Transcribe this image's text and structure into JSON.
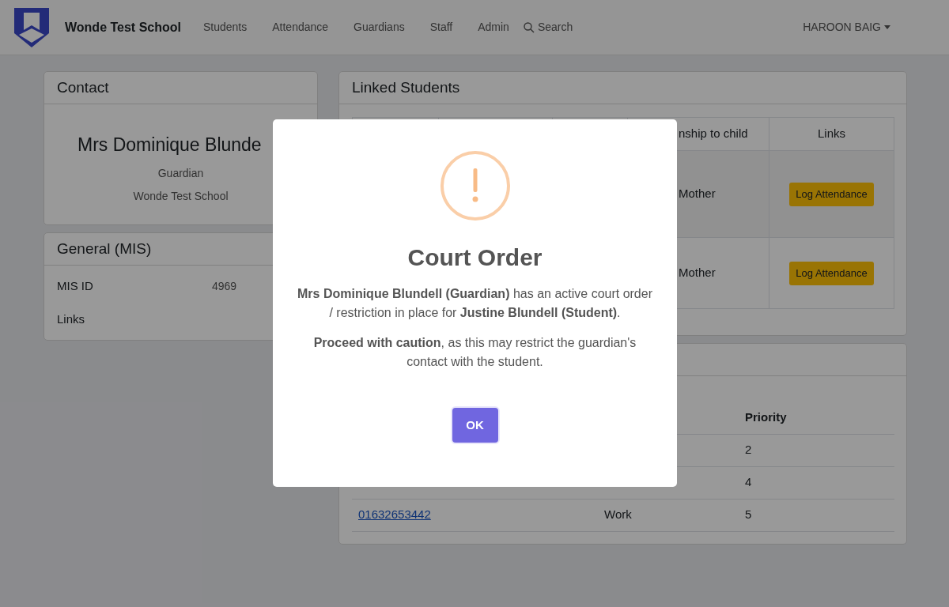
{
  "navbar": {
    "brand": "Wonde Test School",
    "items": [
      {
        "label": "Students"
      },
      {
        "label": "Attendance"
      },
      {
        "label": "Guardians"
      },
      {
        "label": "Staff"
      },
      {
        "label": "Admin"
      }
    ],
    "search": "Search",
    "user": "HAROON BAIG"
  },
  "contact_card": {
    "title": "Contact",
    "name": "Mrs Dominique Blunde",
    "role": "Guardian",
    "school": "Wonde Test School"
  },
  "general_card": {
    "title": "General (MIS)",
    "fields": [
      {
        "label": "MIS ID",
        "value": "4969"
      },
      {
        "label": "Links"
      }
    ]
  },
  "linked_students": {
    "title": "Linked Students",
    "columns": [
      "nship to child",
      "Links"
    ],
    "rows": [
      {
        "relationship": "Mother",
        "button": "Log Attendance"
      },
      {
        "relationship": "Mother",
        "button": "Log Attendance"
      }
    ]
  },
  "contacts": {
    "columns": {
      "column_3": "Priority"
    },
    "rows": [
      {
        "priority": "2"
      },
      {
        "priority": "4"
      },
      {
        "number": "01632653442",
        "type": "Work",
        "priority": "5"
      }
    ]
  },
  "modal": {
    "title": "Court Order",
    "paragraphs": [
      "**Mrs Dominique Blundell (Guardian)** has an active court order / restriction in place for **Justine Blundell (Student)**.",
      "**Proceed with caution**, as this may restrict the guardian's contact with the student."
    ],
    "button": "OK"
  }
}
